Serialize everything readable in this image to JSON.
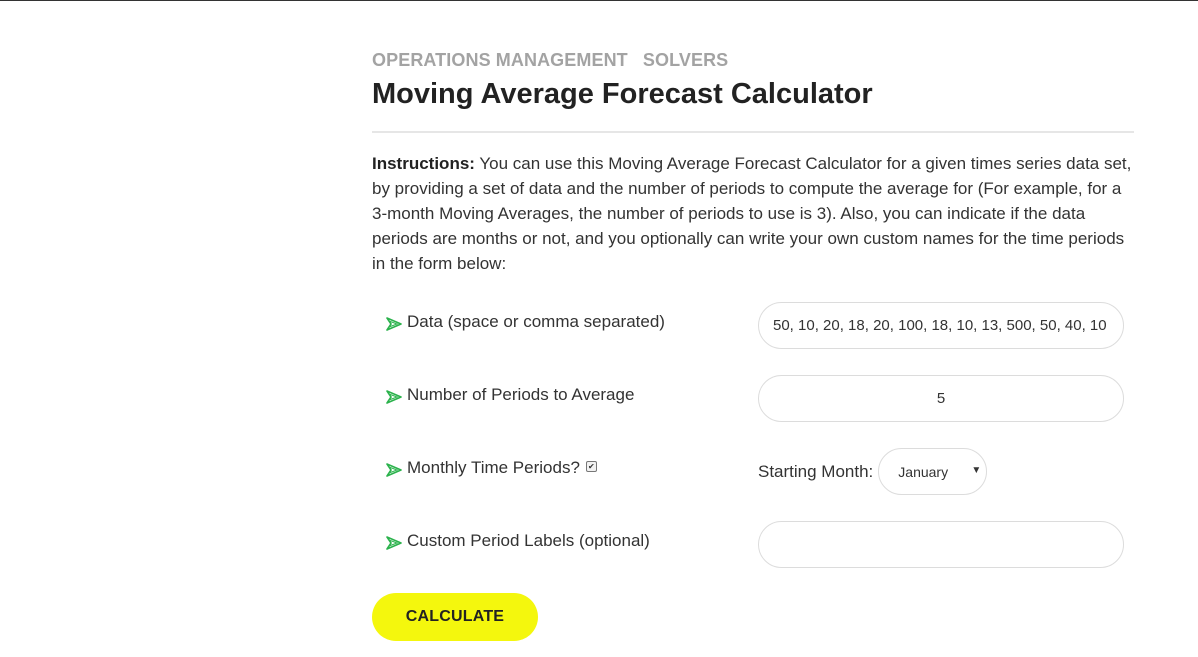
{
  "breadcrumb": {
    "items": [
      "OPERATIONS MANAGEMENT",
      "SOLVERS"
    ]
  },
  "page": {
    "title": "Moving Average Forecast Calculator"
  },
  "instructions": {
    "label": "Instructions:",
    "text": " You can use this Moving Average Forecast Calculator for a given times series data set, by providing a set of data and the number of periods to compute the average for (For example, for a 3-month Moving Averages, the number of periods to use is 3). Also, you can indicate if the data periods are months or not, and you optionally can write your own custom names for the time periods in the form below:"
  },
  "form": {
    "data_label": "Data (space or comma separated)",
    "data_value": "50, 10, 20, 18, 20, 100, 18, 10, 13, 500, 50, 40, 10",
    "periods_label": "Number of Periods to Average",
    "periods_value": "5",
    "monthly_label": "Monthly Time Periods?",
    "monthly_checked": true,
    "starting_month_label": "Starting Month:",
    "starting_month_value": "January",
    "custom_labels_label": "Custom Period Labels (optional)",
    "custom_labels_value": ""
  },
  "actions": {
    "calculate_label": "CALCULATE"
  },
  "icons": {
    "row_bullet": "green-arrow-icon",
    "checkbox": "checkbox-checked-icon",
    "dropdown": "caret-down-icon"
  },
  "colors": {
    "accent_button": "#f4f70d",
    "bullet_green": "#2bb24c",
    "breadcrumb_gray": "#a3a3a3"
  }
}
